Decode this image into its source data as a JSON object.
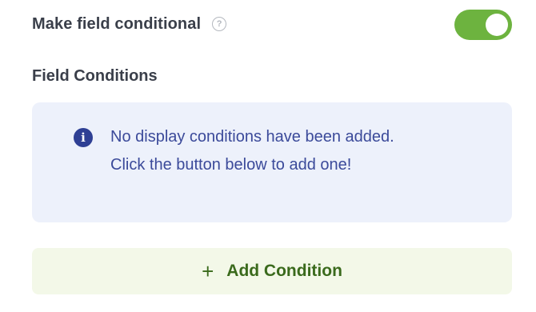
{
  "conditional": {
    "label": "Make field conditional",
    "help_glyph": "?",
    "toggle_on": true
  },
  "conditions": {
    "title": "Field Conditions",
    "notice_icon_glyph": "i",
    "notice_text": "No display conditions have been added. Click the button below to add one!"
  },
  "add_button": {
    "plus_glyph": "+",
    "label": "Add Condition"
  },
  "colors": {
    "accent_green": "#6db33f",
    "notice_bg": "#edf1fb",
    "notice_text": "#3b4a9a",
    "button_bg": "#f3f8e8",
    "button_text": "#3a6a1c"
  }
}
